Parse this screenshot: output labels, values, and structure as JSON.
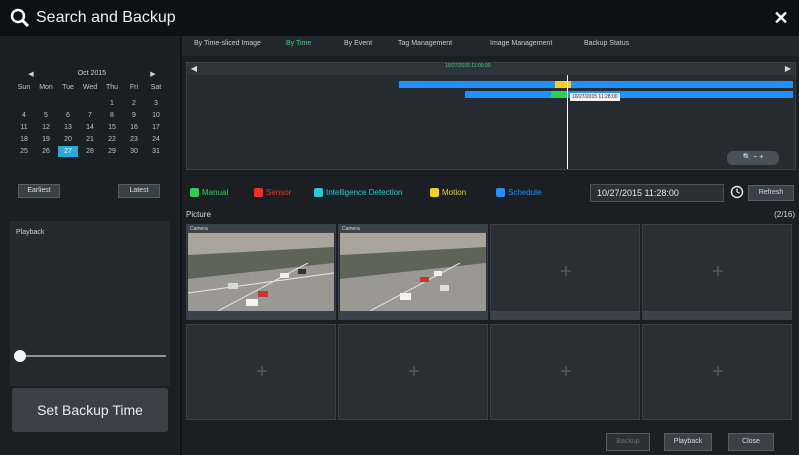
{
  "window": {
    "title": "Search and Backup"
  },
  "tabs": [
    {
      "label": "By Time-sliced Image"
    },
    {
      "label": "By Time"
    },
    {
      "label": "By Event"
    },
    {
      "label": "Tag Management"
    },
    {
      "label": "Image Management"
    },
    {
      "label": "Backup Status"
    }
  ],
  "calendar": {
    "month": "Oct",
    "year": "2015",
    "weekdays": [
      "Sun",
      "Mon",
      "Tue",
      "Wed",
      "Thu",
      "Fri",
      "Sat"
    ],
    "cells": [
      [
        "",
        "",
        "",
        "",
        "1",
        "2",
        "3"
      ],
      [
        "4",
        "5",
        "6",
        "7",
        "8",
        "9",
        "10"
      ],
      [
        "11",
        "12",
        "13",
        "14",
        "15",
        "16",
        "17"
      ],
      [
        "18",
        "19",
        "20",
        "21",
        "22",
        "23",
        "24"
      ],
      [
        "25",
        "26",
        "27",
        "28",
        "29",
        "30",
        "31"
      ]
    ],
    "selected": "27"
  },
  "left": {
    "earliest": "Earliest",
    "latest": "Latest",
    "playback_label": "Playback",
    "set_backup_time": "Set Backup Time"
  },
  "timeline": {
    "marker_label": "10/27/2015 11:00:00",
    "tooltip": "10/27/2015 11:28:00"
  },
  "legend": [
    {
      "label": "Manual",
      "color": "#2bd150"
    },
    {
      "label": "Sensor",
      "color": "#ff2a2a"
    },
    {
      "label": "Intelligence Detection",
      "color": "#27c9d6"
    },
    {
      "label": "Motion",
      "color": "#f4d21f"
    },
    {
      "label": "Schedule",
      "color": "#1e90ff"
    }
  ],
  "time_input": "10/27/2015 11:28:00",
  "refresh": "Refresh",
  "picture": {
    "label": "Picture",
    "count": "(2/16)"
  },
  "thumbnails": [
    {
      "label": "Camera",
      "has_image": true
    },
    {
      "label": "Camera",
      "has_image": true
    },
    {
      "label": "",
      "has_image": false
    },
    {
      "label": "",
      "has_image": false
    },
    {
      "label": "",
      "has_image": false
    },
    {
      "label": "",
      "has_image": false
    },
    {
      "label": "",
      "has_image": false
    },
    {
      "label": "",
      "has_image": false
    }
  ],
  "buttons": {
    "backup": "Backup",
    "playback": "Playback",
    "close": "Close"
  }
}
